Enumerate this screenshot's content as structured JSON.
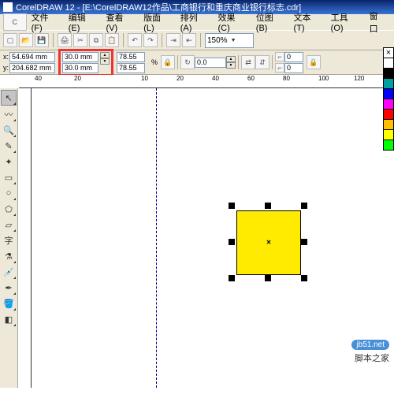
{
  "title": "CorelDRAW 12 - [E:\\CorelDRAW12作品\\工商银行和重庆商业银行标志.cdr]",
  "menu": [
    "文件(F)",
    "编辑(E)",
    "查看(V)",
    "版面(L)",
    "排列(A)",
    "效果(C)",
    "位图(B)",
    "文本(T)",
    "工具(O)",
    "窗口"
  ],
  "zoom": "150%",
  "pos": {
    "x": "54.694 mm",
    "y": "204.682 mm"
  },
  "size": {
    "w": "30.0 mm",
    "h": "30.0 mm"
  },
  "scale": {
    "x": "78.55",
    "y": "78.55"
  },
  "lock_scale_unit": "%",
  "rotate": "0.0",
  "round_x": "0",
  "round_y": "0",
  "ruler_nums": [
    "40",
    "20",
    "10",
    "20",
    "40",
    "60",
    "80",
    "100",
    "120"
  ],
  "watermark": {
    "badge": "jb51.net",
    "text": "脚本之家"
  },
  "palette": [
    "#ffffff",
    "#000000",
    "#00a0a0",
    "#0000ff",
    "#ff00ff",
    "#ff0000",
    "#ffc000",
    "#ffff00",
    "#00ff00"
  ]
}
